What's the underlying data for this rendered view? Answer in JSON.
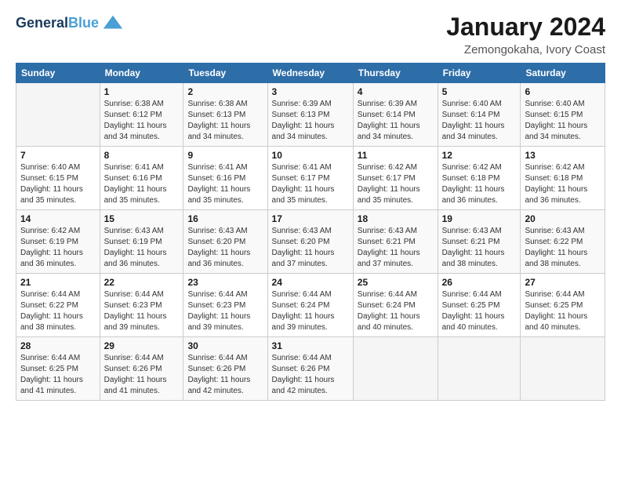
{
  "header": {
    "logo_line1": "General",
    "logo_line2": "Blue",
    "title": "January 2024",
    "subtitle": "Zemongokaha, Ivory Coast"
  },
  "weekdays": [
    "Sunday",
    "Monday",
    "Tuesday",
    "Wednesday",
    "Thursday",
    "Friday",
    "Saturday"
  ],
  "weeks": [
    [
      {
        "day": "",
        "info": ""
      },
      {
        "day": "1",
        "info": "Sunrise: 6:38 AM\nSunset: 6:12 PM\nDaylight: 11 hours\nand 34 minutes."
      },
      {
        "day": "2",
        "info": "Sunrise: 6:38 AM\nSunset: 6:13 PM\nDaylight: 11 hours\nand 34 minutes."
      },
      {
        "day": "3",
        "info": "Sunrise: 6:39 AM\nSunset: 6:13 PM\nDaylight: 11 hours\nand 34 minutes."
      },
      {
        "day": "4",
        "info": "Sunrise: 6:39 AM\nSunset: 6:14 PM\nDaylight: 11 hours\nand 34 minutes."
      },
      {
        "day": "5",
        "info": "Sunrise: 6:40 AM\nSunset: 6:14 PM\nDaylight: 11 hours\nand 34 minutes."
      },
      {
        "day": "6",
        "info": "Sunrise: 6:40 AM\nSunset: 6:15 PM\nDaylight: 11 hours\nand 34 minutes."
      }
    ],
    [
      {
        "day": "7",
        "info": "Sunrise: 6:40 AM\nSunset: 6:15 PM\nDaylight: 11 hours\nand 35 minutes."
      },
      {
        "day": "8",
        "info": "Sunrise: 6:41 AM\nSunset: 6:16 PM\nDaylight: 11 hours\nand 35 minutes."
      },
      {
        "day": "9",
        "info": "Sunrise: 6:41 AM\nSunset: 6:16 PM\nDaylight: 11 hours\nand 35 minutes."
      },
      {
        "day": "10",
        "info": "Sunrise: 6:41 AM\nSunset: 6:17 PM\nDaylight: 11 hours\nand 35 minutes."
      },
      {
        "day": "11",
        "info": "Sunrise: 6:42 AM\nSunset: 6:17 PM\nDaylight: 11 hours\nand 35 minutes."
      },
      {
        "day": "12",
        "info": "Sunrise: 6:42 AM\nSunset: 6:18 PM\nDaylight: 11 hours\nand 36 minutes."
      },
      {
        "day": "13",
        "info": "Sunrise: 6:42 AM\nSunset: 6:18 PM\nDaylight: 11 hours\nand 36 minutes."
      }
    ],
    [
      {
        "day": "14",
        "info": "Sunrise: 6:42 AM\nSunset: 6:19 PM\nDaylight: 11 hours\nand 36 minutes."
      },
      {
        "day": "15",
        "info": "Sunrise: 6:43 AM\nSunset: 6:19 PM\nDaylight: 11 hours\nand 36 minutes."
      },
      {
        "day": "16",
        "info": "Sunrise: 6:43 AM\nSunset: 6:20 PM\nDaylight: 11 hours\nand 36 minutes."
      },
      {
        "day": "17",
        "info": "Sunrise: 6:43 AM\nSunset: 6:20 PM\nDaylight: 11 hours\nand 37 minutes."
      },
      {
        "day": "18",
        "info": "Sunrise: 6:43 AM\nSunset: 6:21 PM\nDaylight: 11 hours\nand 37 minutes."
      },
      {
        "day": "19",
        "info": "Sunrise: 6:43 AM\nSunset: 6:21 PM\nDaylight: 11 hours\nand 38 minutes."
      },
      {
        "day": "20",
        "info": "Sunrise: 6:43 AM\nSunset: 6:22 PM\nDaylight: 11 hours\nand 38 minutes."
      }
    ],
    [
      {
        "day": "21",
        "info": "Sunrise: 6:44 AM\nSunset: 6:22 PM\nDaylight: 11 hours\nand 38 minutes."
      },
      {
        "day": "22",
        "info": "Sunrise: 6:44 AM\nSunset: 6:23 PM\nDaylight: 11 hours\nand 39 minutes."
      },
      {
        "day": "23",
        "info": "Sunrise: 6:44 AM\nSunset: 6:23 PM\nDaylight: 11 hours\nand 39 minutes."
      },
      {
        "day": "24",
        "info": "Sunrise: 6:44 AM\nSunset: 6:24 PM\nDaylight: 11 hours\nand 39 minutes."
      },
      {
        "day": "25",
        "info": "Sunrise: 6:44 AM\nSunset: 6:24 PM\nDaylight: 11 hours\nand 40 minutes."
      },
      {
        "day": "26",
        "info": "Sunrise: 6:44 AM\nSunset: 6:25 PM\nDaylight: 11 hours\nand 40 minutes."
      },
      {
        "day": "27",
        "info": "Sunrise: 6:44 AM\nSunset: 6:25 PM\nDaylight: 11 hours\nand 40 minutes."
      }
    ],
    [
      {
        "day": "28",
        "info": "Sunrise: 6:44 AM\nSunset: 6:25 PM\nDaylight: 11 hours\nand 41 minutes."
      },
      {
        "day": "29",
        "info": "Sunrise: 6:44 AM\nSunset: 6:26 PM\nDaylight: 11 hours\nand 41 minutes."
      },
      {
        "day": "30",
        "info": "Sunrise: 6:44 AM\nSunset: 6:26 PM\nDaylight: 11 hours\nand 42 minutes."
      },
      {
        "day": "31",
        "info": "Sunrise: 6:44 AM\nSunset: 6:26 PM\nDaylight: 11 hours\nand 42 minutes."
      },
      {
        "day": "",
        "info": ""
      },
      {
        "day": "",
        "info": ""
      },
      {
        "day": "",
        "info": ""
      }
    ]
  ]
}
